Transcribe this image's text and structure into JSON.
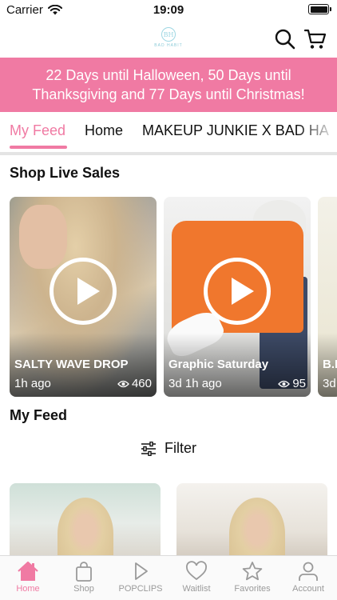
{
  "status_bar": {
    "carrier": "Carrier",
    "time": "19:09"
  },
  "header": {
    "logo_text": "BAD HABIT",
    "logo_mark": "BH"
  },
  "banner": {
    "line1": "22 Days until Halloween, 50 Days until",
    "line2": "Thanksgiving and 77 Days until Christmas!"
  },
  "tabs": [
    {
      "label": "My Feed",
      "active": true
    },
    {
      "label": "Home",
      "active": false
    },
    {
      "label": "MAKEUP JUNKIE X BAD HA",
      "active": false
    }
  ],
  "shop_live": {
    "title": "Shop Live Sales",
    "cards": [
      {
        "title": "SALTY WAVE DROP",
        "time": "1h ago",
        "views": "460"
      },
      {
        "title": "Graphic Saturday",
        "time": "3d 1h ago",
        "views": "95"
      },
      {
        "title": "B.L",
        "time": "3d"
      }
    ]
  },
  "feed": {
    "title": "My Feed",
    "filter_label": "Filter"
  },
  "bottom_nav": [
    {
      "label": "Home",
      "icon": "home-icon",
      "active": true
    },
    {
      "label": "Shop",
      "icon": "bag-icon",
      "active": false
    },
    {
      "label": "POPCLIPS",
      "icon": "play-icon",
      "active": false
    },
    {
      "label": "Waitlist",
      "icon": "heart-icon",
      "active": false
    },
    {
      "label": "Favorites",
      "icon": "star-icon",
      "active": false
    },
    {
      "label": "Account",
      "icon": "person-icon",
      "active": false
    }
  ],
  "colors": {
    "accent": "#f07aa3",
    "nav_inactive": "#9a9a9a"
  }
}
